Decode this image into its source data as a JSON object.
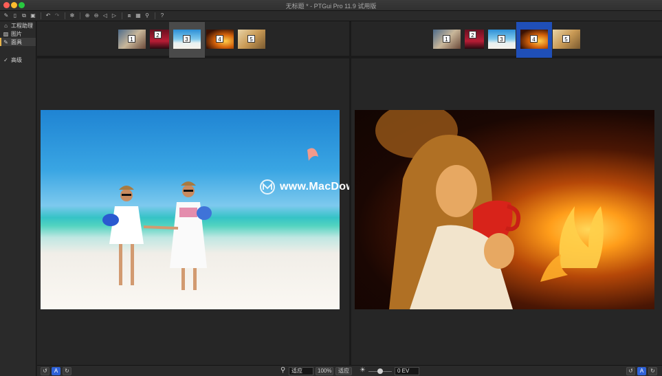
{
  "window": {
    "title": "无标题 * - PTGui Pro 11.9 试用版"
  },
  "toolbar": {
    "icons": [
      "new-project-icon",
      "open-icon",
      "copy-icon",
      "save-icon",
      "undo-icon",
      "redo-icon",
      "settings-icon",
      "zoom-in-icon",
      "zoom-out-icon",
      "prev-icon",
      "next-icon",
      "panorama-editor-icon",
      "table-icon",
      "control-points-icon",
      "help-icon"
    ],
    "glyphs": {
      "new": "✎",
      "open": "▯",
      "copy": "⧉",
      "save": "▣",
      "undo": "↶",
      "redo": "↷",
      "settings": "✻",
      "zoom_in": "⊕",
      "zoom_out": "⊖",
      "prev": "◁",
      "next": "▷",
      "pano": "⧈",
      "table": "▦",
      "cp": "⚲",
      "help": "?"
    }
  },
  "sidebar": {
    "items": [
      {
        "label": "工程助理",
        "icon": "⌂"
      },
      {
        "label": "图片",
        "icon": "▨"
      },
      {
        "label": "面具",
        "icon": "✎",
        "active": true
      }
    ],
    "advanced": {
      "label": "高级",
      "icon": "✓"
    }
  },
  "left_panel": {
    "thumbs": [
      "1",
      "2",
      "3",
      "4",
      "5"
    ],
    "selected": "3"
  },
  "right_panel": {
    "thumbs": [
      "1",
      "2",
      "3",
      "4",
      "5"
    ],
    "selected": "4"
  },
  "watermark": {
    "text": "www.MacDown.com"
  },
  "bottom": {
    "left_rotate_ccw": "↺",
    "left_auto": "A",
    "left_rotate_cw": "↻",
    "zoom_icon": "⚲",
    "fit_left": "适应",
    "zoom_pct": "100%",
    "fit_right": "适应",
    "sun_icon": "☀",
    "ev_value": "0 EV",
    "right_rotate_ccw": "↺",
    "right_auto": "A",
    "right_rotate_cw": "↻"
  },
  "colors": {
    "active_marker": "#e6b34a",
    "selection_blue": "#1f4fb8",
    "button_blue": "#2f62d8"
  }
}
